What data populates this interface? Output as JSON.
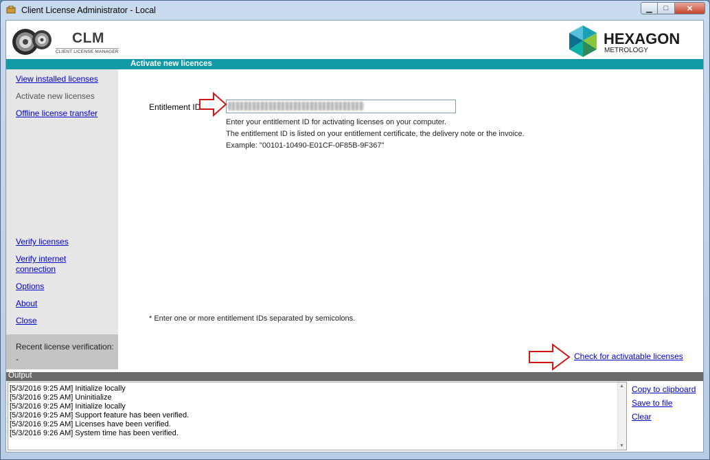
{
  "window": {
    "title": "Client License Administrator - Local",
    "buttons": {
      "minimize": "▁",
      "maximize": "□",
      "close": "✕"
    }
  },
  "logo": {
    "clm_title": "CLM",
    "clm_subtitle": "CLIENT LICENSE MANAGER",
    "brand_name": "HEXAGON",
    "brand_sub": "METROLOGY"
  },
  "header": {
    "title": "Activate new licences"
  },
  "sidebar": {
    "items": [
      {
        "label": "View installed licenses",
        "active": false
      },
      {
        "label": "Activate new licenses",
        "active": true
      },
      {
        "label": "Offline license transfer",
        "active": false
      }
    ],
    "bottom_items": [
      {
        "label": "Verify licenses"
      },
      {
        "label": "Verify internet"
      },
      {
        "label": "connection"
      },
      {
        "label": "Options"
      },
      {
        "label": "About"
      },
      {
        "label": "Close"
      }
    ],
    "recent": {
      "label": "Recent license verification:",
      "value": "-"
    }
  },
  "main": {
    "entitlement_label": "Entitlement IDs*:",
    "entitlement_value": "",
    "help_lines": [
      "Enter your entitlement ID for activating licenses on your computer.",
      "The entitlement ID is listed on your entitlement certificate, the delivery note or the invoice.",
      "Example: \"00101-10490-E01CF-0F85B-9F367\""
    ],
    "footnote": "* Enter one or more entitlement IDs separated by semicolons.",
    "check_link": "Check for activatable licenses"
  },
  "output": {
    "title": "Output",
    "lines": [
      "[5/3/2016 9:25 AM] Initialize locally",
      "[5/3/2016 9:25 AM] Uninitialize",
      "[5/3/2016 9:25 AM] Initialize locally",
      "[5/3/2016 9:25 AM] Support feature has been verified.",
      "[5/3/2016 9:25 AM] Licenses have been verified.",
      "[5/3/2016 9:26 AM] System time has been verified."
    ],
    "actions": {
      "copy": "Copy to clipboard",
      "save": "Save to file",
      "clear": "Clear"
    }
  },
  "colors": {
    "header": "#139aa8",
    "link": "#0000cc",
    "annotation_arrow": "#d01515"
  }
}
